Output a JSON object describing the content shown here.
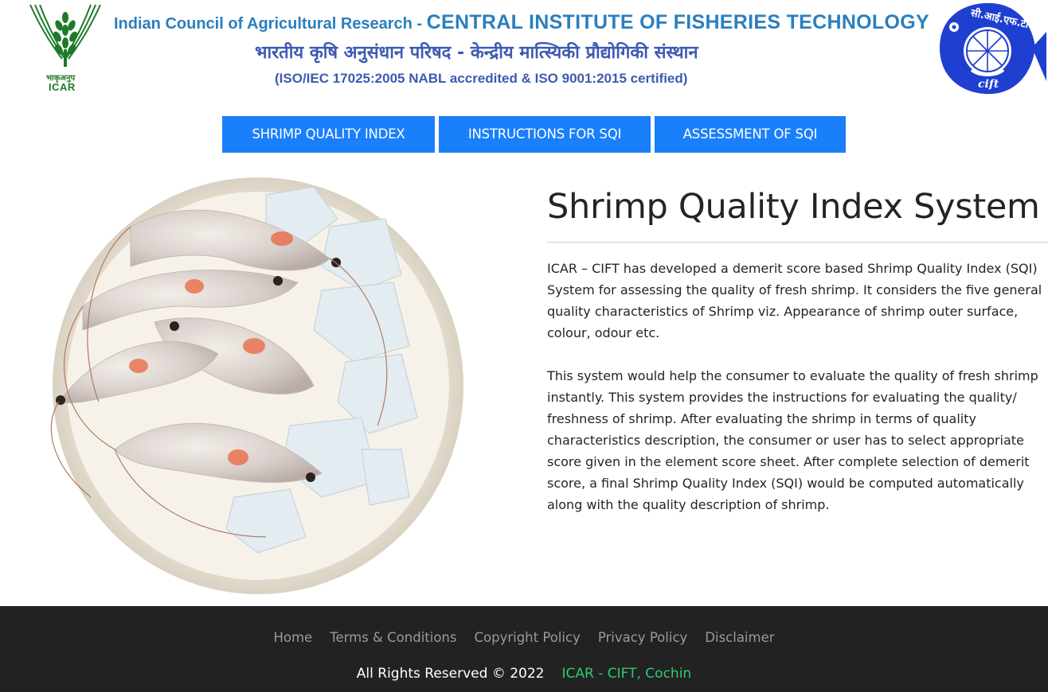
{
  "header": {
    "line1_prefix": "Indian Council of Agricultural Research - ",
    "line1_institute": "CENTRAL INSTITUTE OF FISHERIES TECHNOLOGY",
    "line2_hindi": "भारतीय कृषि अनुसंधान परिषद - केन्द्रीय मात्स्यिकी प्रौद्योगिकी संस्थान",
    "line3_cert": "(ISO/IEC 17025:2005 NABL accredited & ISO 9001:2015 certified)",
    "icar_logo_hindi": "भाकृअनुप",
    "icar_logo_text": "ICAR",
    "cift_logo_hindi": "सी.आई.एफ.टी",
    "cift_logo_text": "cift"
  },
  "nav": {
    "items": [
      {
        "label": "SHRIMP QUALITY INDEX"
      },
      {
        "label": "INSTRUCTIONS FOR SQI"
      },
      {
        "label": "ASSESSMENT OF SQI"
      }
    ]
  },
  "main": {
    "title": "Shrimp Quality Index System",
    "paragraphs": [
      "ICAR – CIFT has developed a demerit score based Shrimp Quality Index (SQI) System for assessing the quality of fresh shrimp. It considers the five general quality characteristics of Shrimp viz. Appearance of shrimp outer surface, colour, odour etc.",
      "This system would help the consumer to evaluate the quality of fresh shrimp instantly. This system provides the instructions for evaluating the quality/ freshness of shrimp. After evaluating the shrimp in terms of quality characteristics description, the consumer or user has to select appropriate score given in the element score sheet. After complete selection of demerit score, a final Shrimp Quality Index (SQI) would be computed automatically along with the quality description of shrimp."
    ]
  },
  "footer": {
    "links": [
      "Home",
      "Terms & Conditions",
      "Copyright Policy",
      "Privacy Policy",
      "Disclaimer"
    ],
    "copyright": "All Rights Reserved © 2022",
    "org": "ICAR - CIFT, Cochin"
  },
  "colors": {
    "nav_button": "#1a7ffb",
    "footer_bg": "#222222",
    "footer_link": "#9a9a9a",
    "org_link": "#2ecc71",
    "banner_blue": "#2a7fbf",
    "banner_dark_blue": "#3d5ab3",
    "icar_green": "#1e7a2a"
  }
}
